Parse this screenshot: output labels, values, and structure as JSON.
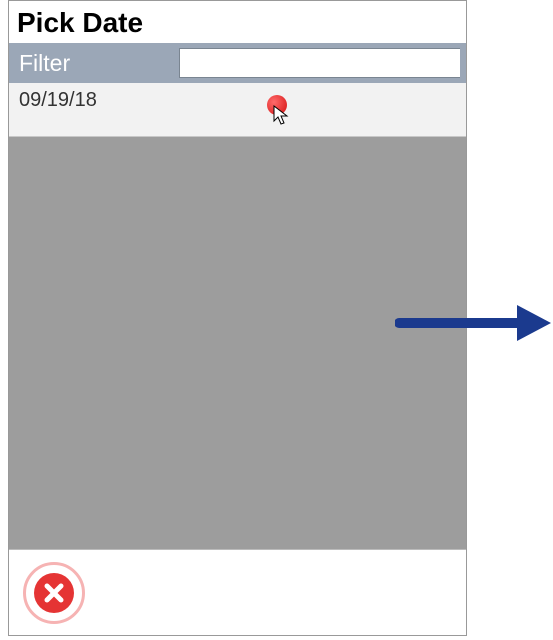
{
  "title": "Pick Date",
  "filter": {
    "label": "Filter",
    "value": "",
    "placeholder": ""
  },
  "list": {
    "items": [
      {
        "date": "09/19/18"
      }
    ]
  },
  "colors": {
    "filter_bar_bg": "#9ba7b7",
    "list_bg": "#9d9d9d",
    "close_red": "#e53434",
    "arrow_blue": "#1b3a8e"
  },
  "annotations": {
    "red_dot": true,
    "cursor": true,
    "arrow": true
  }
}
